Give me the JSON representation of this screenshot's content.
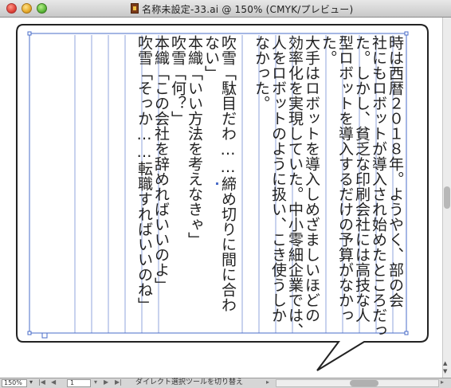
{
  "window": {
    "title": "名称未設定-33.ai @ 150% (CMYK/プレビュー)"
  },
  "columns": [
    "時は西暦２０１８年。ようやく、部の会",
    "社にもロボットが導入され始めたところだっ",
    "た。しかし、貧乏な印刷会社には高技な人",
    "型ロボットを導入するだけの予算がなかっ",
    "た。",
    "大手はロボットを導入しめざましいほどの",
    "効率化を実現していた。中小零細企業では、",
    "人をロボットのように扱い、こき使うしか",
    "なかった。",
    "",
    "吹雪「駄目だわ……締め切りに間に合わ",
    "ない」",
    "本織「いい方法を考えなきゃ」",
    "吹雪「何？」",
    "本織「この会社を辞めればいいのよ」",
    "吹雪「そっか……転職すればいいのね」"
  ],
  "status": {
    "zoom": "150%",
    "page": "1",
    "text": "ダイレクト選択ツールを切り替え"
  },
  "colors": {
    "selection": "#4a6cc8",
    "bubble_stroke": "#222222"
  }
}
